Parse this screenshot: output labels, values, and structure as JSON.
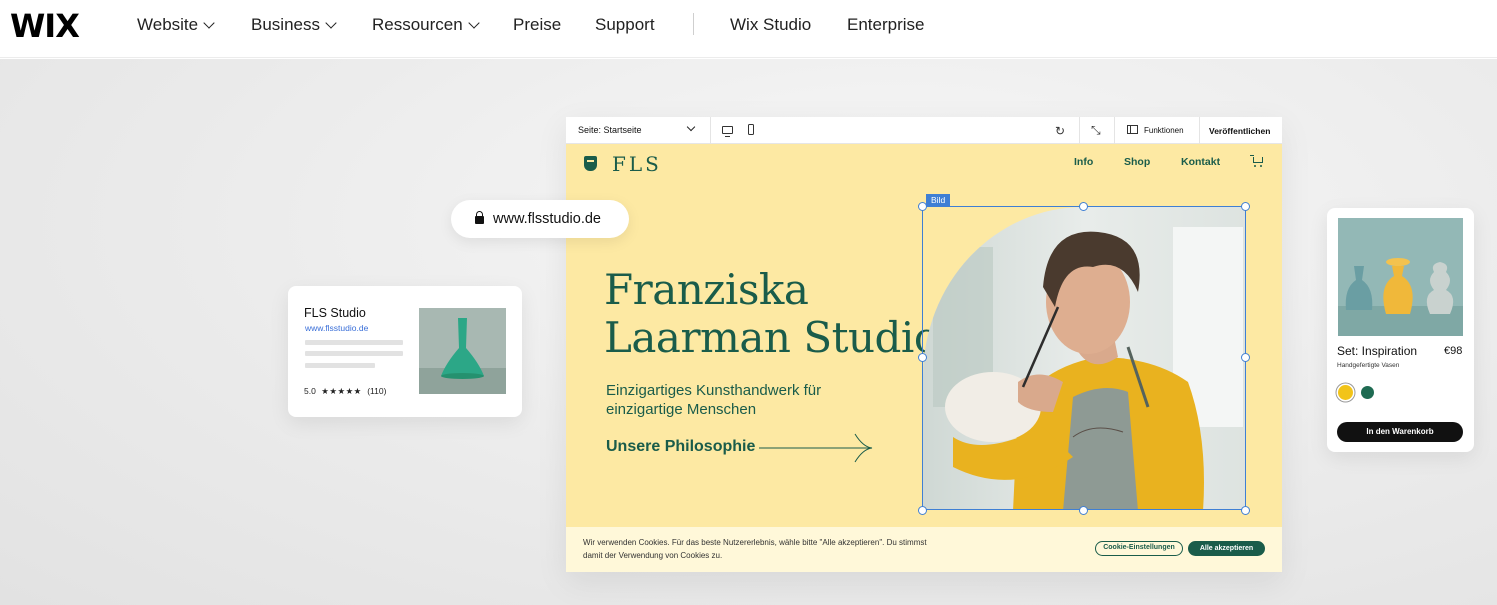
{
  "nav": {
    "logo": "WIX",
    "items": [
      {
        "label": "Website",
        "dropdown": true
      },
      {
        "label": "Business",
        "dropdown": true
      },
      {
        "label": "Ressourcen",
        "dropdown": true
      },
      {
        "label": "Preise",
        "dropdown": false
      },
      {
        "label": "Support",
        "dropdown": false
      }
    ],
    "right_items": [
      "Wix Studio",
      "Enterprise"
    ]
  },
  "editor": {
    "toolbar": {
      "page_label": "Seite: Startseite",
      "functions_label": "Funktionen",
      "publish_label": "Veröffentlichen"
    },
    "site": {
      "logo": "FLS",
      "nav": [
        "Info",
        "Shop",
        "Kontakt"
      ],
      "title_line1": "Franziska",
      "title_line2": "Laarman Studio",
      "subtitle": "Einzigartiges Kunsthandwerk für einzigartige Menschen",
      "link": "Unsere Philosophie",
      "image_tag": "Bild"
    },
    "cookie": {
      "text": "Wir verwenden Cookies. Für das beste Nutzererlebnis, wähle bitte \"Alle akzeptieren\". Du stimmst damit der Verwendung von Cookies zu.",
      "settings_label": "Cookie-Einstellungen",
      "accept_label": "Alle akzeptieren"
    }
  },
  "url_pill": {
    "url": "www.flsstudio.de"
  },
  "seo_card": {
    "title": "FLS Studio",
    "url": "www.flsstudio.de",
    "rating": "5.0",
    "stars": "★★★★★",
    "reviews": "(110)"
  },
  "product_card": {
    "name": "Set: Inspiration",
    "price": "€98",
    "subtitle": "Handgefertigte Vasen",
    "swatches": [
      "#f2c419",
      "#1f6b52"
    ],
    "button_label": "In den Warenkorb"
  },
  "colors": {
    "brand_green": "#1a5c4a",
    "site_bg": "#fde9a3",
    "selection_blue": "#3f7fd4"
  }
}
